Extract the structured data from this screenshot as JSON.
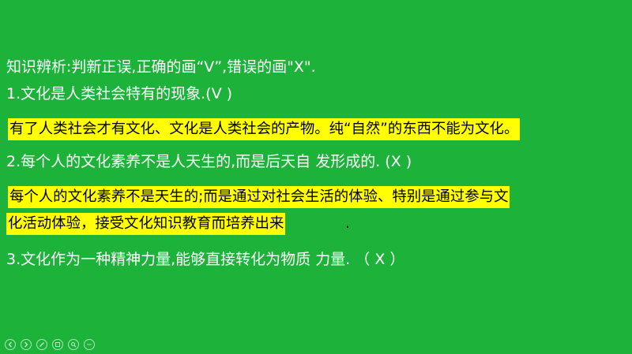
{
  "slide": {
    "heading": "知识辨析:判新正误,正确的画“V”,错误的画\"X\".",
    "q1": "1.文化是人类社会特有的现象.(V )",
    "a1": "有了人类社会才有文化、文化是人类社会的产物。纯“自然”的东西不能为文化。",
    "q2": "2.每个人的文化素养不是人天生的,而是后天自 发形成的. (X  )",
    "a2_line1": "每个人的文化素养不是天生的;而是通过对社会生活的体验、特别是通过参与文",
    "a2_line2": "化活动体验，接受文化知识教育而培养出来",
    "a2_tail": ".",
    "q3": "3.文化作为一种精神力量,能够直接转化为物质 力量.  （ X  ）"
  },
  "colors": {
    "background": "#1db33a",
    "highlight": "#ffff00",
    "text": "#ffffff",
    "answer_text": "#000000"
  },
  "toolbar": {
    "icons": [
      "prev-icon",
      "next-icon",
      "pen-icon",
      "slides-icon",
      "zoom-icon",
      "more-icon"
    ]
  }
}
